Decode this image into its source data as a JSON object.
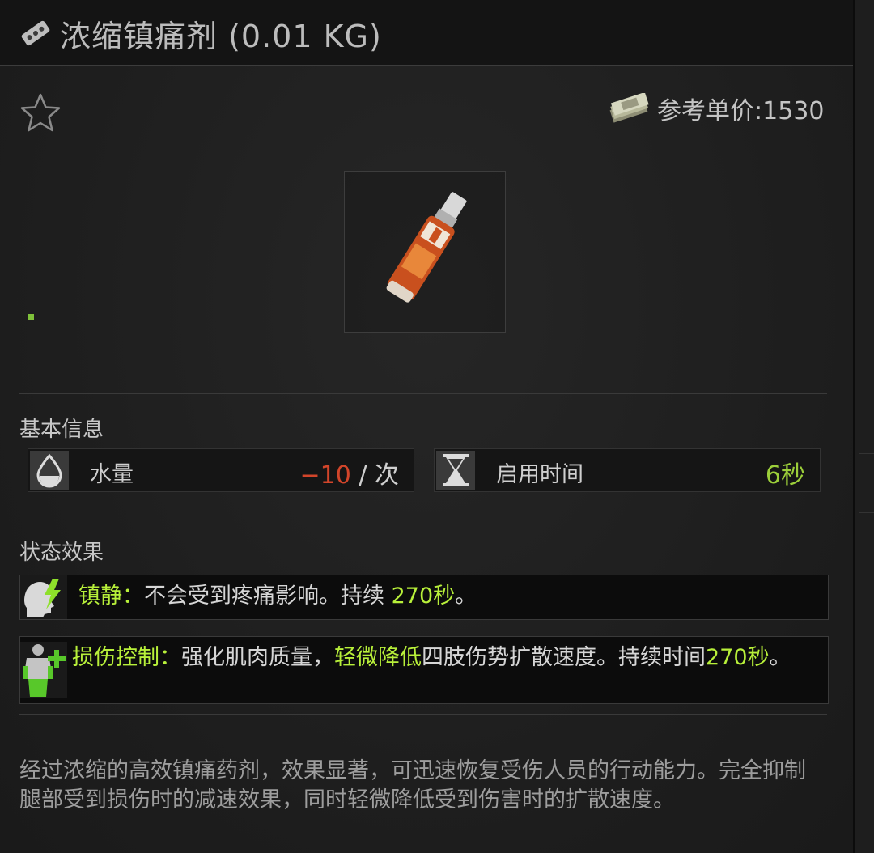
{
  "window": {
    "title": "浓缩镇痛剂 (0.01 KG)",
    "title_icon": "pill-blister-icon"
  },
  "header": {
    "favorite_icon": "star-outline-icon",
    "price_icon": "money-stack-icon",
    "price_label": "参考单价:1530"
  },
  "item": {
    "image": "painkiller-tube-image"
  },
  "basic_info": {
    "heading": "基本信息",
    "stats": [
      {
        "icon": "water-drop-icon",
        "label": "水量",
        "value": "−10",
        "unit": "/ 次",
        "value_color": "#d2452a"
      },
      {
        "icon": "hourglass-icon",
        "label": "启用时间",
        "value": "6秒",
        "value_color": "#9ccf3a"
      }
    ]
  },
  "status_effects": {
    "heading": "状态效果",
    "effects": [
      {
        "icon": "head-lightning-icon",
        "name": "镇静：",
        "text": "不会受到疼痛影响。持续 ",
        "duration": "270秒",
        "end": "。"
      },
      {
        "icon": "body-plus-icon",
        "name": "损伤控制：",
        "text_pre": "强化肌肉质量，",
        "highlight": "轻微降低",
        "text_post": "四肢伤势扩散速度。持续时间",
        "duration_num": "270",
        "duration_unit": "秒",
        "end": "。"
      }
    ]
  },
  "description": "经过浓缩的高效镇痛药剂，效果显著，可迅速恢复受伤人员的行动能力。完全抑制腿部受到损伤时的减速效果，同时轻微降低受到伤害时的扩散速度。",
  "colors": {
    "accent_green": "#b8f03a",
    "negative_red": "#d2452a",
    "background": "#1b1b1b"
  }
}
